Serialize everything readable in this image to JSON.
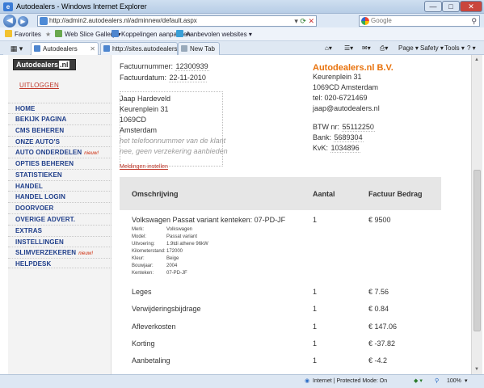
{
  "window": {
    "title": "Autodealers - Windows Internet Explorer",
    "minimize": "—",
    "maximize": "□",
    "close": "✕"
  },
  "address_bar": {
    "url": "http://admin2.autodealers.nl/adminnew/default.aspx",
    "search_placeholder": "Google"
  },
  "favorites_bar": {
    "favorites": "Favorites",
    "items": [
      "Web Slice Gallery ▾",
      "Koppelingen aanpassen",
      "Aanbevolen websites ▾"
    ]
  },
  "tabs": [
    {
      "label": "Autodealers",
      "active": true
    },
    {
      "label": "http://sites.autodealers.nl/...",
      "active": false
    },
    {
      "label": "New Tab",
      "active": false
    }
  ],
  "command_bar": {
    "page": "Page ▾",
    "safety": "Safety ▾",
    "tools": "Tools ▾",
    "help": "? ▾"
  },
  "sidebar": {
    "logo": "Autodealers",
    "logo_suffix": ".nl",
    "logout": "UITLOGGEN",
    "items": [
      {
        "label": "HOME",
        "badge": ""
      },
      {
        "label": "BEKIJK PAGINA",
        "badge": ""
      },
      {
        "label": "CMS BEHEREN",
        "badge": ""
      },
      {
        "label": "ONZE AUTO'S",
        "badge": ""
      },
      {
        "label": "AUTO ONDERDELEN",
        "badge": "nieuw!"
      },
      {
        "label": "OPTIES BEHEREN",
        "badge": ""
      },
      {
        "label": "STATISTIEKEN",
        "badge": ""
      },
      {
        "label": "HANDEL",
        "badge": ""
      },
      {
        "label": "HANDEL LOGIN",
        "badge": ""
      },
      {
        "label": "DOORVOER",
        "badge": ""
      },
      {
        "label": "OVERIGE ADVERT.",
        "badge": ""
      },
      {
        "label": "EXTRAS",
        "badge": ""
      },
      {
        "label": "INSTELLINGEN",
        "badge": ""
      },
      {
        "label": "SLIMVERZEKEREN",
        "badge": "nieuw!"
      },
      {
        "label": "HELPDESK",
        "badge": ""
      }
    ]
  },
  "invoice": {
    "number_label": "Factuurnummer:",
    "number": "12300939",
    "date_label": "Factuurdatum:",
    "date": "22-11-2010",
    "customer": {
      "name": "Jaap Hardeveld",
      "street": "Keurenplein 31",
      "postcode": "1069CD",
      "city": "Amsterdam",
      "phone_placeholder": "het telefoonnummer van de klant",
      "insurance_placeholder": "nee, geen verzekering aanbieden"
    },
    "company": {
      "name": "Autodealers.nl B.V.",
      "street": "Keurenplein 31",
      "city": "1069CD Amsterdam",
      "tel": "tel: 020-6721469",
      "email": "jaap@autodealers.nl",
      "btw_label": "BTW nr:",
      "btw": "55112250",
      "bank_label": "Bank:",
      "bank": "5689304",
      "kvk_label": "KvK:",
      "kvk": "1034896"
    },
    "notifications_link": "Meldingen instellen",
    "columns": {
      "description": "Omschrijving",
      "quantity": "Aantal",
      "amount": "Factuur Bedrag"
    },
    "vehicle": {
      "title": "Volkswagen Passat variant kenteken: 07-PD-JF",
      "quantity": "1",
      "amount": "€ 9500",
      "specs": [
        {
          "label": "Merk:",
          "value": "Volkswagen"
        },
        {
          "label": "Model:",
          "value": "Passat variant"
        },
        {
          "label": "Uitvoering:",
          "value": "1.9tdi athene 96kW"
        },
        {
          "label": "Kilometerstand:",
          "value": "172000"
        },
        {
          "label": "Kleur:",
          "value": "Beige"
        },
        {
          "label": "Bouwjaar:",
          "value": "2004"
        },
        {
          "label": "Kenteken:",
          "value": "07-PD-JF"
        }
      ]
    },
    "lines": [
      {
        "description": "Leges",
        "quantity": "1",
        "amount": "€ 7.56"
      },
      {
        "description": "Verwijderingsbijdrage",
        "quantity": "1",
        "amount": "€ 0.84"
      },
      {
        "description": "Afleverkosten",
        "quantity": "1",
        "amount": "€ 147.06"
      },
      {
        "description": "Korting",
        "quantity": "1",
        "amount": "€ -37.82"
      },
      {
        "description": "Aanbetaling",
        "quantity": "1",
        "amount": "€ -4.2"
      }
    ]
  },
  "status_bar": {
    "zone": "Internet | Protected Mode: On",
    "zoom": "100%"
  }
}
